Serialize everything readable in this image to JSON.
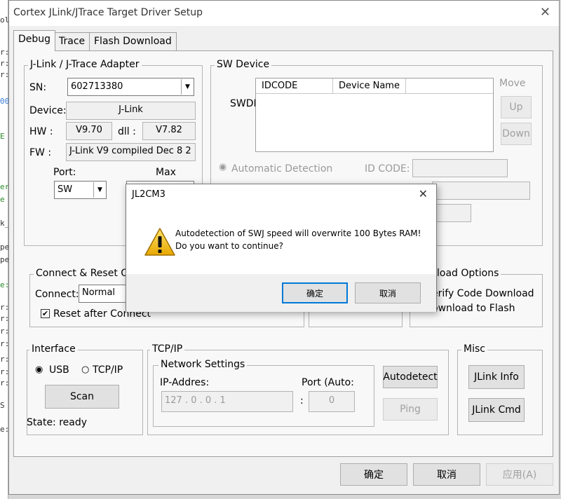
{
  "window": {
    "title": "Cortex JLink/JTrace Target Driver Setup"
  },
  "tabs": [
    "Debug",
    "Trace",
    "Flash Download"
  ],
  "adapter": {
    "group_label": "J-Link / J-Trace Adapter",
    "sn_label": "SN:",
    "sn_value": "602713380",
    "device_label": "Device:",
    "device_value": "J-Link",
    "hw_label": "HW :",
    "hw_value": "V9.70",
    "dll_label": "dll :",
    "dll_value": "V7.82",
    "fw_label": "FW :",
    "fw_value": "J-Link V9 compiled Dec  8 2",
    "port_label": "Port:",
    "max_label": "Max",
    "port_value": "SW"
  },
  "sw_device": {
    "group_label": "SW Device",
    "swdi_label": "SWDI",
    "col_idcode": "IDCODE",
    "col_device_name": "Device Name",
    "move_label": "Move",
    "up_button": "Up",
    "down_button": "Down",
    "auto_detect": "Automatic Detection",
    "id_code_label": "ID CODE:"
  },
  "connect": {
    "group_label": "Connect & Reset Op",
    "connect_label": "Connect:",
    "connect_value": "Normal",
    "reset_label": "Reset after Connect"
  },
  "download": {
    "group_label": "load Options",
    "verify": "erify Code Download",
    "to_flash": "ownload to Flash"
  },
  "interface": {
    "group_label": "Interface",
    "usb": "USB",
    "tcpip": "TCP/IP",
    "scan_button": "Scan",
    "state": "State: ready"
  },
  "tcpip": {
    "group_label": "TCP/IP",
    "network_label": "Network Settings",
    "ip_label": "IP-Addres:",
    "port_label": "Port (Auto:",
    "ip_value": "127  .   0   .   0   .   1",
    "port_value": "0",
    "autodetect_button": "Autodetect",
    "ping_button": "Ping"
  },
  "misc": {
    "group_label": "Misc",
    "jlink_info_button": "JLink Info",
    "jlink_cmd_button": "JLink Cmd"
  },
  "footer": {
    "ok_button": "确定",
    "cancel_button": "取消",
    "apply_button": "应用(A)"
  },
  "popup": {
    "title": "JL2CM3",
    "message_line1": "Autodetection of SWJ speed will overwrite 100 Bytes RAM!",
    "message_line2": "Do you want to continue?",
    "ok_button": "确定",
    "cancel_button": "取消"
  },
  "background_fragments": [
    "ole",
    "r:",
    "r:",
    "r:",
    "00",
    "E",
    "er",
    "e",
    "k_",
    "pe",
    "pe",
    "e:",
    "r:",
    "r:",
    "r:",
    "r:",
    "r:",
    "r:",
    "r:",
    "S",
    "e:"
  ]
}
